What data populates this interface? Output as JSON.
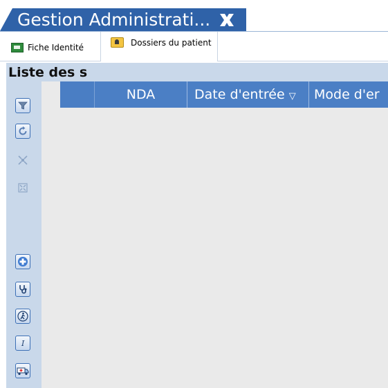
{
  "document_tab": {
    "title": "Gestion Administrati...",
    "close_icon": "close-x-icon"
  },
  "subtabs": [
    {
      "label": "Fiche Identité",
      "icon": "id-card-icon"
    },
    {
      "label": "Dossiers du patient",
      "icon": "folder-patient-icon",
      "active": true
    }
  ],
  "section": {
    "title": "Liste des s"
  },
  "toolbar": {
    "buttons": [
      {
        "icon": "filter-icon"
      },
      {
        "icon": "refresh-icon"
      },
      {
        "icon": "collapse-icon"
      },
      {
        "icon": "expand-icon"
      },
      {
        "icon": "add-icon"
      },
      {
        "icon": "stethoscope-icon"
      },
      {
        "icon": "patient-walking-icon"
      },
      {
        "icon": "info-icon"
      },
      {
        "icon": "ambulance-icon"
      }
    ]
  },
  "grid": {
    "columns": [
      {
        "label": "NDA"
      },
      {
        "label": "Date d'entrée",
        "sort": "▽"
      },
      {
        "label": "Mode d'er"
      }
    ],
    "rows": []
  },
  "colors": {
    "header_blue": "#4b7fc5",
    "tab_blue": "#2f62a8",
    "panel_blue": "#c9d8ea",
    "grid_bg": "#eaeaea"
  }
}
